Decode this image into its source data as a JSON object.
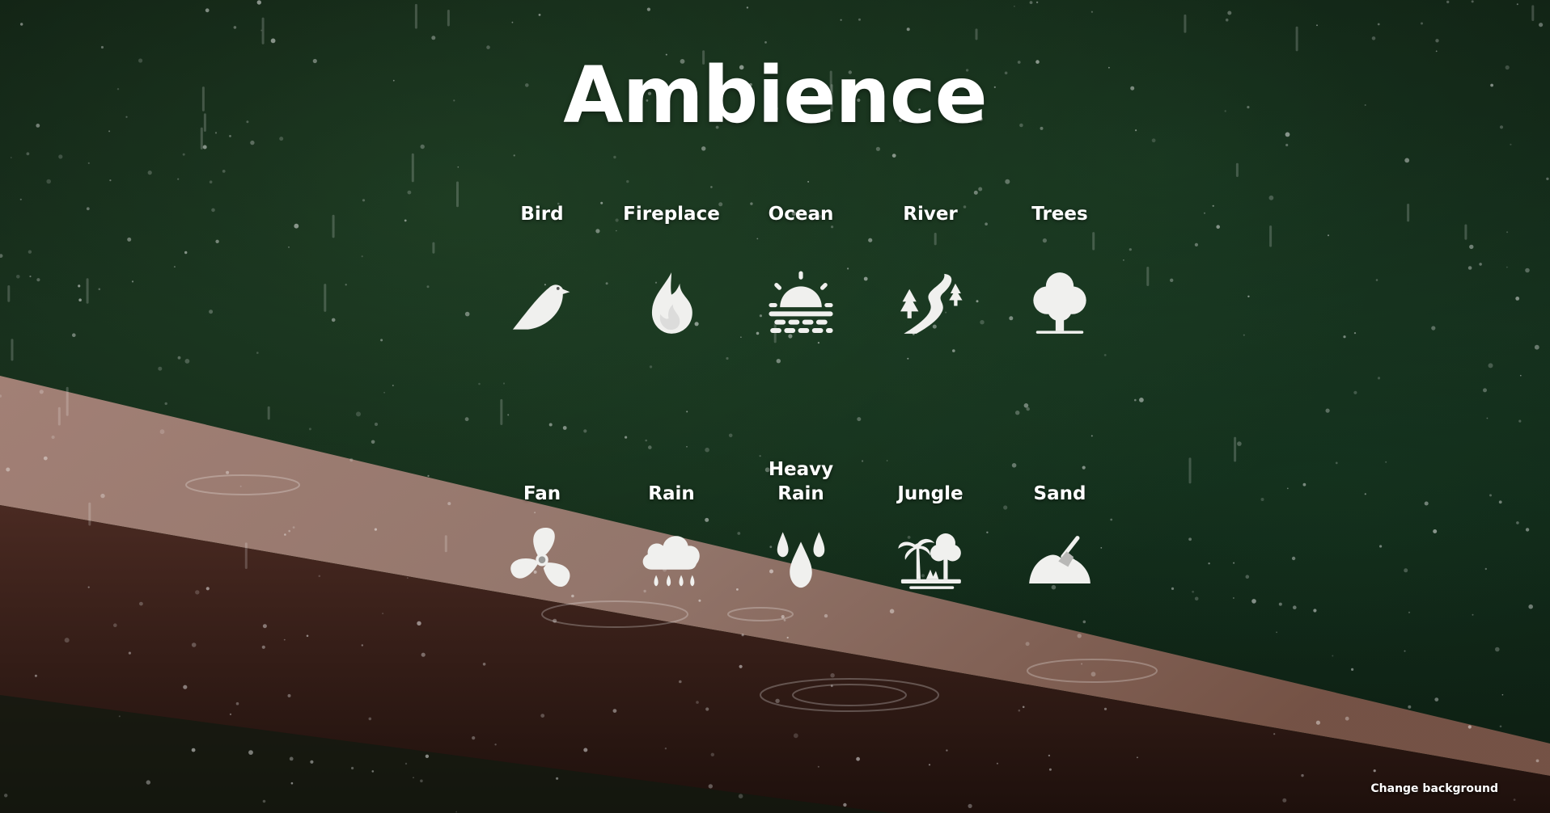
{
  "title": "Ambience",
  "sounds": [
    {
      "label": "Bird",
      "icon": "bird-icon"
    },
    {
      "label": "Fireplace",
      "icon": "flame-icon"
    },
    {
      "label": "Ocean",
      "icon": "sunset-ocean-icon"
    },
    {
      "label": "River",
      "icon": "river-icon"
    },
    {
      "label": "Trees",
      "icon": "tree-icon"
    },
    {
      "label": "Fan",
      "icon": "fan-icon"
    },
    {
      "label": "Rain",
      "icon": "rain-cloud-icon"
    },
    {
      "label": "Heavy Rain",
      "icon": "droplets-icon"
    },
    {
      "label": "Jungle",
      "icon": "jungle-icon"
    },
    {
      "label": "Sand",
      "icon": "sand-shovel-icon"
    }
  ],
  "change_background_label": "Change background",
  "colors": {
    "icon": "#f0f0ee",
    "text": "#ffffff",
    "railing": "#6a4030"
  }
}
